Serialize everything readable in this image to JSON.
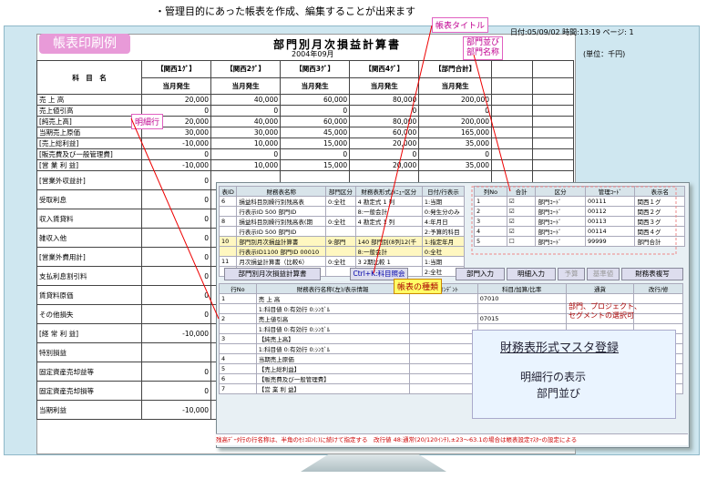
{
  "top_note": "・管理目的にあった帳表を作成、編集することが出来ます",
  "tab_title": "帳表印刷例",
  "report": {
    "title": "部門別月次損益計算書",
    "date": "2004年09月",
    "meta": "日付:05/09/02  時間:13:19  ページ:  1",
    "unit": "(単位：千円)",
    "col_header": "科　目　名",
    "depts": [
      "【関西1ｸﾞ】",
      "【関西2ｸﾞ】",
      "【関西3ｸﾞ】",
      "【関西4ｸﾞ】",
      "【部門合計】"
    ],
    "sub": "当月発生",
    "rows": [
      {
        "name": "売 上 高",
        "v": [
          "20,000",
          "40,000",
          "60,000",
          "80,000",
          "200,000"
        ]
      },
      {
        "name": "売上値引高",
        "v": [
          "0",
          "0",
          "0",
          "0",
          "0"
        ]
      },
      {
        "name": "[純売上高]",
        "v": [
          "20,000",
          "40,000",
          "60,000",
          "80,000",
          "200,000"
        ]
      },
      {
        "name": "当期売上原価",
        "v": [
          "30,000",
          "30,000",
          "45,000",
          "60,000",
          "165,000"
        ]
      },
      {
        "name": "[売上総利益]",
        "v": [
          "-10,000",
          "10,000",
          "15,000",
          "20,000",
          "35,000"
        ]
      },
      {
        "name": "[販売費及び一般管理費]",
        "v": [
          "0",
          "0",
          "0",
          "0",
          "0"
        ]
      },
      {
        "name": "[営 業 利 益]",
        "v": [
          "-10,000",
          "10,000",
          "15,000",
          "20,000",
          "35,000"
        ]
      },
      {
        "name": "[営業外収益計]",
        "v": [
          "0",
          "",
          "",
          "",
          ""
        ]
      },
      {
        "name": "受取利息",
        "v": [
          "0",
          "",
          "",
          "",
          ""
        ]
      },
      {
        "name": "収入賃貸料",
        "v": [
          "0",
          "",
          "",
          "",
          ""
        ]
      },
      {
        "name": "雑収入他",
        "v": [
          "0",
          "",
          "",
          "",
          ""
        ]
      },
      {
        "name": "[営業外費用計]",
        "v": [
          "0",
          "",
          "",
          "",
          ""
        ]
      },
      {
        "name": "支払利息割引料",
        "v": [
          "0",
          "",
          "",
          "",
          ""
        ]
      },
      {
        "name": "賃貸料原価",
        "v": [
          "0",
          "",
          "",
          "",
          ""
        ]
      },
      {
        "name": "その他損失",
        "v": [
          "0",
          "",
          "",
          "",
          ""
        ]
      },
      {
        "name": "[経 常 利 益]",
        "v": [
          "-10,000",
          "",
          "",
          "",
          ""
        ]
      },
      {
        "name": "特別損益",
        "v": [
          "",
          "",
          "",
          "",
          ""
        ]
      },
      {
        "name": "固定資産売却益等",
        "v": [
          "0",
          "",
          "",
          "",
          ""
        ]
      },
      {
        "name": "固定資産売却損等",
        "v": [
          "0",
          "",
          "",
          "",
          ""
        ]
      },
      {
        "name": "当期利益",
        "v": [
          "-10,000",
          "",
          "",
          "",
          ""
        ]
      }
    ]
  },
  "callouts": {
    "report_title": "帳表タイトル",
    "dept_order": "部門並び",
    "dept_name": "部門名称",
    "detail_row": "明細行",
    "report_type": "帳表の種類",
    "segment": "部門、プロジェクト、",
    "segment2": "セグメントの選択可"
  },
  "window": {
    "list_headers": [
      "表ID",
      "財務表名称",
      "部門区分",
      "財務表形式/ﾒﾆｭｰ区分",
      "日付/行表示"
    ],
    "list_rows": [
      [
        "6",
        "損益科目別繰行別残高表",
        "0:全社",
        "4 勘定式 1 列",
        "1:当期"
      ],
      [
        "",
        "行表示ID 500 部門ID",
        "",
        "8:一般会計",
        "0:発生分のみ"
      ],
      [
        "8",
        "損益科目別繰行別残高表(期",
        "0:全社",
        "4 勘定式 1 列",
        "4:年月日"
      ],
      [
        "",
        "行表示ID 500 部門ID",
        "",
        "",
        "2:予算的科目"
      ],
      [
        "10",
        "部門別月次損益計算書",
        "9:部門",
        "140 部門別(8列12(千",
        "1:指定年月"
      ],
      [
        "",
        "行表示ID1100 部門ID 00010",
        "",
        "8:一般会計",
        "0:全社"
      ],
      [
        "11",
        "月次損益計算書（比較6）",
        "0:全社",
        "3 2期比較 1",
        "1:当期"
      ],
      [
        "",
        "行表示ID1100 部門ID",
        "",
        "8:一般会計",
        "2:全社"
      ]
    ],
    "dept_headers": [
      "列No",
      "合計",
      "区分",
      "管理ｺｰﾄﾞ",
      "表示名"
    ],
    "dept_rows": [
      [
        "1",
        "☑",
        "部門ｺｰﾄﾞ",
        "00111",
        "関西１グ"
      ],
      [
        "2",
        "☑",
        "部門ｺｰﾄﾞ",
        "00112",
        "関西２グ"
      ],
      [
        "3",
        "☑",
        "部門ｺｰﾄﾞ",
        "00113",
        "関西３グ"
      ],
      [
        "4",
        "☑",
        "部門ｺｰﾄﾞ",
        "00114",
        "関西４グ"
      ],
      [
        "5",
        "☐",
        "部門ｺｰﾄﾞ",
        "99999",
        "部門合計"
      ]
    ],
    "report_name": "部門別月次損益計算書",
    "shortcut": "Ctrl+K:科目照会",
    "buttons": [
      "部門入力",
      "明細入力",
      "予算",
      "基準値",
      "財務表複写"
    ],
    "detail_headers": [
      "行No",
      "財務表行名称(左)/表示情報",
      "通貨ｲﾝﾃﾞﾝﾄ",
      "科目/加算/比率",
      "通貨",
      "改行/修"
    ],
    "detail_rows": [
      [
        "1",
        "売 上 高",
        "07010",
        ""
      ],
      [
        "",
        "1:科目値  0:有効行  0:ｼﾝｶﾞﾙ",
        "",
        ""
      ],
      [
        "2",
        "売上値引高",
        "07015",
        ""
      ],
      [
        "",
        "1:科目値  0:有効行  0:ｼﾝｶﾞﾙ",
        "",
        ""
      ],
      [
        "3",
        "【純売上高】",
        "07099",
        "1:基準科目"
      ],
      [
        "",
        "1:科目値  0:有効行  0:ｼﾝｶﾞﾙ",
        "",
        ""
      ],
      [
        "4",
        "当期売上原価",
        "07470",
        ""
      ],
      [
        "5",
        "【売上総利益】",
        "07490",
        ""
      ],
      [
        "6",
        "【販売費及び一般管理費】",
        "07610",
        ""
      ],
      [
        "7",
        "【営 業 利 益】",
        "07820",
        ""
      ]
    ],
    "status": "残高ﾃﾞｰﾀ行の行名称は、半角のｾﾐｺﾛﾝ(;)に続けて指定する　改行値 48:通常(20/120ｲﾝﾁ),±23～63.1の場合は帳表設定ﾏｽﾀｰの設定による"
  },
  "big_callout": {
    "l1": "財務表形式マスタ登録",
    "l2": "明細行の表示",
    "l3": "部門並び"
  }
}
